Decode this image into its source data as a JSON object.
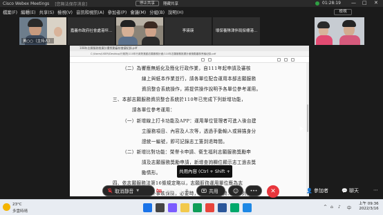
{
  "titlebar": {
    "app_title": "Cisco Webex Meetings",
    "meeting_note": "[您無法保存消息]",
    "share_label": "停止共享",
    "hide_label": "隱藏共享",
    "elapsed": "01:28:19",
    "win_min": "—",
    "win_max": "□",
    "win_close": "✕"
  },
  "menu": [
    "檔案(F)",
    "編輯(E)",
    "共享(S)",
    "檢視(V)",
    "音訊和視訊(A)",
    "參加者(P)",
    "會議(M)",
    "分組(B)",
    "說明(H)"
  ],
  "view_button": "檢視",
  "participants": [
    {
      "name": "黃○○（主持人）"
    },
    {
      "name": "嘉義市政府社會處港坪..."
    },
    {
      "name": ""
    },
    {
      "name": "李瑛瑛"
    },
    {
      "name": "壞保養隊津伴局探標港..."
    },
    {
      "name": ""
    }
  ],
  "document": {
    "tab_title": "108年志願服務推廣計畫獎勵審核會議紀錄.pdf",
    "address": "C:/Users/USER/Desktop/行政院/110年行政院推動志願服務計畫/110年志願服務推廣計畫獎勵審核會議紀錄.pdf",
    "lines": [
      "（二）為響應無紙化及簡化行政作業，自111年起申請及審核",
      "線上與紙本作業並行，請各單位配合運用本部志願服務",
      "資訊整合系統操作，將提供操作說明予各單位參考運用。",
      "三、本部志願服務資訊整合系統於110年已完成下列新增功能，",
      "請各單位參考運用：",
      "（一）新增線上打卡功能及APP：運用單位管理者可進入後台建",
      "立服務項目、內容及人次等，透過手動輸入或掃描身分",
      "證統一編號，即可記錄志工簽到退時間。",
      "（二）新增比對功能：榮譽卡申請、衛生福利志願服務獎勵申",
      "請及志願服務獎勵申請，新增查詢欄位顯示志工過去獎",
      "勵情形。",
      "四、依志願服務法第16條規定略以，志願服務運用單位應為志",
      "工辦理意外事故保險，必要時，得補助交通費、本部到正辦"
    ]
  },
  "tooltip": "共用內容 (Ctrl + Shift + D)",
  "controls": {
    "mute": "取消靜音",
    "video": "開始視訊",
    "share": "共用",
    "participants": "參加者",
    "chat": "聊天",
    "end": "✕",
    "more": "•••"
  },
  "taskbar": {
    "temp": "23°C",
    "condition": "多雲時晴",
    "lang": "中",
    "time": "上午 09:36",
    "date": "2022/3/16"
  },
  "colors": {
    "end_red": "#e8363d",
    "accent_blue": "#1a73e8",
    "rec_green": "#2ea043"
  }
}
